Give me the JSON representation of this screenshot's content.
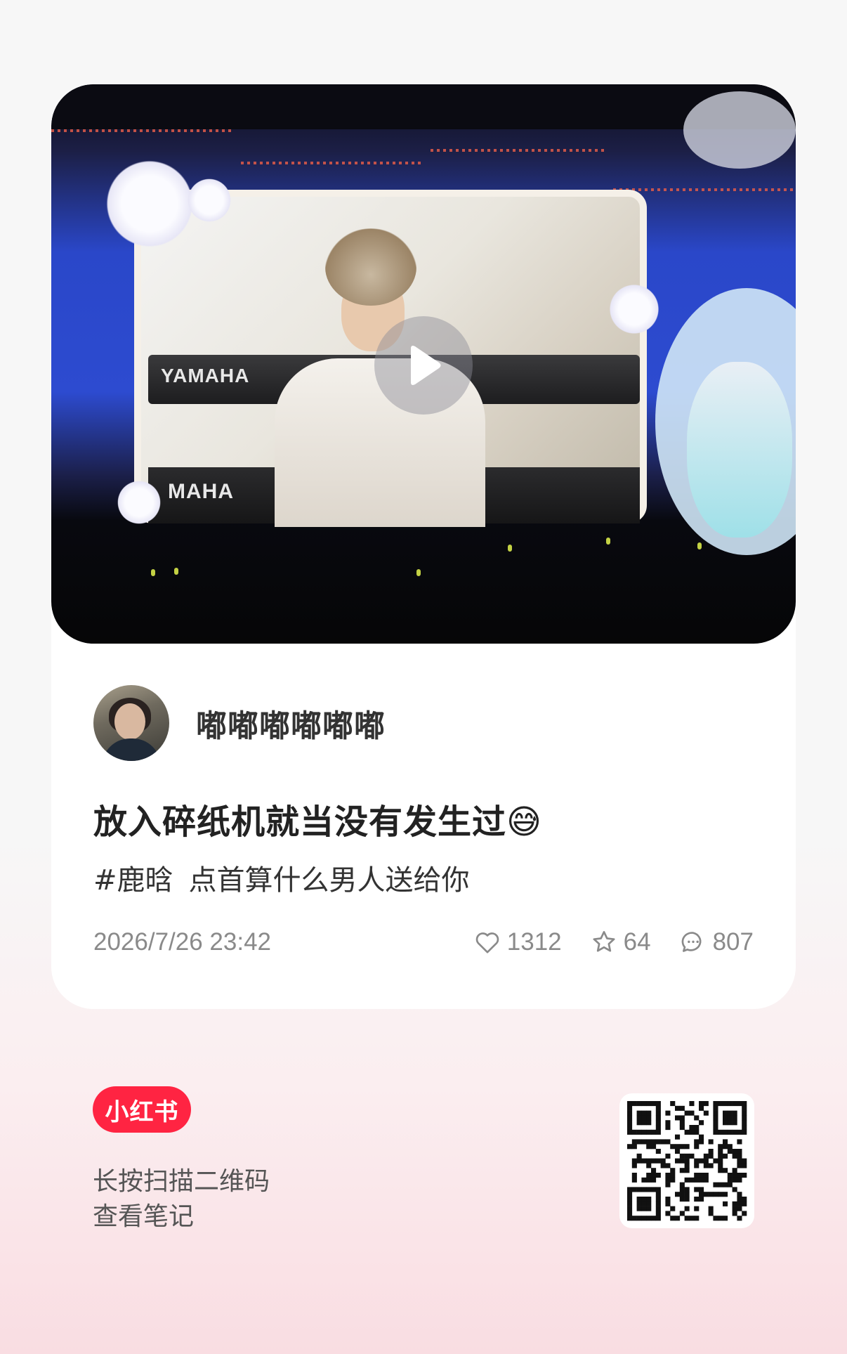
{
  "author": {
    "name": "嘟嘟嘟嘟嘟嘟"
  },
  "post": {
    "title": "放入碎纸机就当没有发生过😅",
    "hashtag": "#鹿晗",
    "description": "点首算什么男人送给你",
    "timestamp": "2026/7/26 23:42",
    "likes": "1312",
    "favorites": "64",
    "comments": "807"
  },
  "video": {
    "screen_brand_top": "YAMAHA",
    "screen_brand_bottom": "MAHA"
  },
  "footer": {
    "logo": "小红书",
    "scan_line1": "长按扫描二维码",
    "scan_line2": "查看笔记"
  },
  "colors": {
    "brand": "#ff2442",
    "meta": "#8a8a8a"
  },
  "icons": [
    "play-icon",
    "heart-icon",
    "star-icon",
    "comment-icon",
    "qr-code"
  ]
}
